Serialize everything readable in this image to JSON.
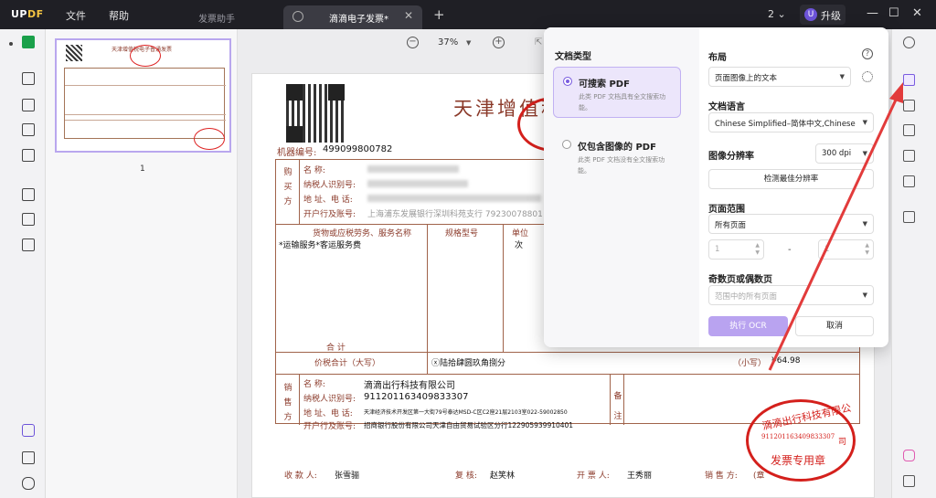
{
  "titlebar": {
    "logo_u": "UP",
    "logo_df": "DF",
    "menu_file": "文件",
    "menu_help": "帮助",
    "assistant_tab": "发票助手",
    "doc_tab_title": "滴滴电子发票*",
    "new_tab": "+",
    "page_count": "2 ⌄",
    "upgrade_badge": "U",
    "upgrade_label": "升级",
    "minimize": "—",
    "maximize": "☐",
    "close": "✕"
  },
  "thumbnail": {
    "page_number": "1",
    "mini_title": "天津增值税电子普通发票"
  },
  "zoom": {
    "minus": "−",
    "value": "37%",
    "caret": "▼",
    "plus": "+",
    "fit": "⇱"
  },
  "invoice": {
    "title": "天津增值税",
    "machine_label": "机器编号:",
    "machine_no": "499099800782",
    "buyer_side": [
      "购",
      "买",
      "方"
    ],
    "buyer_fields": [
      "名       称:",
      "纳税人识别号:",
      "地 址、电 话:",
      "开户行及账号:"
    ],
    "buyer_bank_partial": "上海浦东发展银行深圳科苑支行  79230078801",
    "goods_header": "货物或应税劳务、服务名称",
    "spec_header": "规格型号",
    "unit_header": "单位",
    "goods_item": "*运输服务*客运服务费",
    "unit_value": "次",
    "subtotal_label": "合          计",
    "subtotal_amount": "¥64.98",
    "total_label": "价税合计（大写）",
    "total_upper": "ⓧ陆拾肆圆玖角捌分",
    "total_small_label": "（小写）",
    "total_small_value": "¥64.98",
    "seller_side": [
      "销",
      "售",
      "方"
    ],
    "seller_fields": [
      "名       称:",
      "纳税人识别号:",
      "地 址、电 话:",
      "开户行及账号:"
    ],
    "seller_name": "滴滴出行科技有限公司",
    "seller_taxid": "911201163409833307",
    "seller_address": "天津经济技术开发区第一大街79号泰达MSD-C区C2座21层2103室022-59002850",
    "seller_bank": "招商银行股份有限公司天津自由贸易试验区分行122905939910401",
    "remarks_side": [
      "备",
      "注"
    ],
    "payee_label": "收  款  人:",
    "payee": "张雪骊",
    "reviewer_label": "复      核:",
    "reviewer": "赵笑林",
    "issuer_label": "开  票  人:",
    "issuer": "王秀丽",
    "seller_sign_label": "销  售  方:",
    "seller_sign_suffix": "(章",
    "stamp_top": "滴滴出行科技有限公",
    "stamp_mid": "911201163409833307",
    "stamp_bottom": "发票专用章",
    "stamp_suffix": "司"
  },
  "ocr_panel": {
    "doc_type_title": "文档类型",
    "option_searchable_title": "可搜索 PDF",
    "option_searchable_desc": "此类 PDF 文档具有全文搜索功能。",
    "option_image_title": "仅包含图像的 PDF",
    "option_image_desc": "此类 PDF 文档没有全文搜索功能。",
    "layout_title": "布局",
    "layout_value": "页面图像上的文本",
    "language_title": "文档语言",
    "language_value": "Chinese Simplified–简体中文,Chinese ...",
    "resolution_title": "图像分辨率",
    "resolution_value": "300 dpi",
    "detect_button": "检测最佳分辨率",
    "page_range_title": "页面范围",
    "page_range_value": "所有页面",
    "range_from": "1",
    "range_to": "1",
    "range_dash": "-",
    "odd_even_title": "奇数页或偶数页",
    "odd_even_value": "范围中的所有页面",
    "run_button": "执行 OCR",
    "cancel_button": "取消",
    "help": "?"
  },
  "colors": {
    "accent": "#7a5ce0",
    "invoice_red": "#8b3a2a",
    "stamp_red": "#d4201c",
    "annotation_red": "#e23b3b"
  }
}
